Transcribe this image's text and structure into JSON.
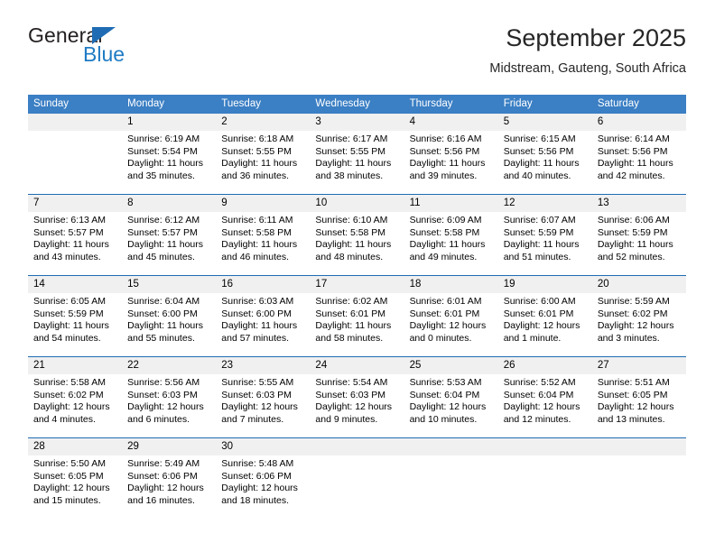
{
  "brand": {
    "name_top": "General",
    "name_bottom": "Blue",
    "triangle_icon": "brand-triangle-icon",
    "colors": {
      "dark": "#231f20",
      "blue": "#1f7bc4"
    }
  },
  "header": {
    "title": "September 2025",
    "subtitle": "Midstream, Gauteng, South Africa"
  },
  "colors": {
    "header_band": "#3b7fc4",
    "week_divider": "#1f6cb4",
    "daynum_band": "#f0f0f0",
    "text": "#000000"
  },
  "weekdays": [
    "Sunday",
    "Monday",
    "Tuesday",
    "Wednesday",
    "Thursday",
    "Friday",
    "Saturday"
  ],
  "weeks": [
    {
      "days": [
        {
          "num": "",
          "lines": []
        },
        {
          "num": "1",
          "lines": [
            "Sunrise: 6:19 AM",
            "Sunset: 5:54 PM",
            "Daylight: 11 hours",
            "and 35 minutes."
          ]
        },
        {
          "num": "2",
          "lines": [
            "Sunrise: 6:18 AM",
            "Sunset: 5:55 PM",
            "Daylight: 11 hours",
            "and 36 minutes."
          ]
        },
        {
          "num": "3",
          "lines": [
            "Sunrise: 6:17 AM",
            "Sunset: 5:55 PM",
            "Daylight: 11 hours",
            "and 38 minutes."
          ]
        },
        {
          "num": "4",
          "lines": [
            "Sunrise: 6:16 AM",
            "Sunset: 5:56 PM",
            "Daylight: 11 hours",
            "and 39 minutes."
          ]
        },
        {
          "num": "5",
          "lines": [
            "Sunrise: 6:15 AM",
            "Sunset: 5:56 PM",
            "Daylight: 11 hours",
            "and 40 minutes."
          ]
        },
        {
          "num": "6",
          "lines": [
            "Sunrise: 6:14 AM",
            "Sunset: 5:56 PM",
            "Daylight: 11 hours",
            "and 42 minutes."
          ]
        }
      ]
    },
    {
      "days": [
        {
          "num": "7",
          "lines": [
            "Sunrise: 6:13 AM",
            "Sunset: 5:57 PM",
            "Daylight: 11 hours",
            "and 43 minutes."
          ]
        },
        {
          "num": "8",
          "lines": [
            "Sunrise: 6:12 AM",
            "Sunset: 5:57 PM",
            "Daylight: 11 hours",
            "and 45 minutes."
          ]
        },
        {
          "num": "9",
          "lines": [
            "Sunrise: 6:11 AM",
            "Sunset: 5:58 PM",
            "Daylight: 11 hours",
            "and 46 minutes."
          ]
        },
        {
          "num": "10",
          "lines": [
            "Sunrise: 6:10 AM",
            "Sunset: 5:58 PM",
            "Daylight: 11 hours",
            "and 48 minutes."
          ]
        },
        {
          "num": "11",
          "lines": [
            "Sunrise: 6:09 AM",
            "Sunset: 5:58 PM",
            "Daylight: 11 hours",
            "and 49 minutes."
          ]
        },
        {
          "num": "12",
          "lines": [
            "Sunrise: 6:07 AM",
            "Sunset: 5:59 PM",
            "Daylight: 11 hours",
            "and 51 minutes."
          ]
        },
        {
          "num": "13",
          "lines": [
            "Sunrise: 6:06 AM",
            "Sunset: 5:59 PM",
            "Daylight: 11 hours",
            "and 52 minutes."
          ]
        }
      ]
    },
    {
      "days": [
        {
          "num": "14",
          "lines": [
            "Sunrise: 6:05 AM",
            "Sunset: 5:59 PM",
            "Daylight: 11 hours",
            "and 54 minutes."
          ]
        },
        {
          "num": "15",
          "lines": [
            "Sunrise: 6:04 AM",
            "Sunset: 6:00 PM",
            "Daylight: 11 hours",
            "and 55 minutes."
          ]
        },
        {
          "num": "16",
          "lines": [
            "Sunrise: 6:03 AM",
            "Sunset: 6:00 PM",
            "Daylight: 11 hours",
            "and 57 minutes."
          ]
        },
        {
          "num": "17",
          "lines": [
            "Sunrise: 6:02 AM",
            "Sunset: 6:01 PM",
            "Daylight: 11 hours",
            "and 58 minutes."
          ]
        },
        {
          "num": "18",
          "lines": [
            "Sunrise: 6:01 AM",
            "Sunset: 6:01 PM",
            "Daylight: 12 hours",
            "and 0 minutes."
          ]
        },
        {
          "num": "19",
          "lines": [
            "Sunrise: 6:00 AM",
            "Sunset: 6:01 PM",
            "Daylight: 12 hours",
            "and 1 minute."
          ]
        },
        {
          "num": "20",
          "lines": [
            "Sunrise: 5:59 AM",
            "Sunset: 6:02 PM",
            "Daylight: 12 hours",
            "and 3 minutes."
          ]
        }
      ]
    },
    {
      "days": [
        {
          "num": "21",
          "lines": [
            "Sunrise: 5:58 AM",
            "Sunset: 6:02 PM",
            "Daylight: 12 hours",
            "and 4 minutes."
          ]
        },
        {
          "num": "22",
          "lines": [
            "Sunrise: 5:56 AM",
            "Sunset: 6:03 PM",
            "Daylight: 12 hours",
            "and 6 minutes."
          ]
        },
        {
          "num": "23",
          "lines": [
            "Sunrise: 5:55 AM",
            "Sunset: 6:03 PM",
            "Daylight: 12 hours",
            "and 7 minutes."
          ]
        },
        {
          "num": "24",
          "lines": [
            "Sunrise: 5:54 AM",
            "Sunset: 6:03 PM",
            "Daylight: 12 hours",
            "and 9 minutes."
          ]
        },
        {
          "num": "25",
          "lines": [
            "Sunrise: 5:53 AM",
            "Sunset: 6:04 PM",
            "Daylight: 12 hours",
            "and 10 minutes."
          ]
        },
        {
          "num": "26",
          "lines": [
            "Sunrise: 5:52 AM",
            "Sunset: 6:04 PM",
            "Daylight: 12 hours",
            "and 12 minutes."
          ]
        },
        {
          "num": "27",
          "lines": [
            "Sunrise: 5:51 AM",
            "Sunset: 6:05 PM",
            "Daylight: 12 hours",
            "and 13 minutes."
          ]
        }
      ]
    },
    {
      "days": [
        {
          "num": "28",
          "lines": [
            "Sunrise: 5:50 AM",
            "Sunset: 6:05 PM",
            "Daylight: 12 hours",
            "and 15 minutes."
          ]
        },
        {
          "num": "29",
          "lines": [
            "Sunrise: 5:49 AM",
            "Sunset: 6:06 PM",
            "Daylight: 12 hours",
            "and 16 minutes."
          ]
        },
        {
          "num": "30",
          "lines": [
            "Sunrise: 5:48 AM",
            "Sunset: 6:06 PM",
            "Daylight: 12 hours",
            "and 18 minutes."
          ]
        },
        {
          "num": "",
          "lines": []
        },
        {
          "num": "",
          "lines": []
        },
        {
          "num": "",
          "lines": []
        },
        {
          "num": "",
          "lines": []
        }
      ]
    }
  ]
}
